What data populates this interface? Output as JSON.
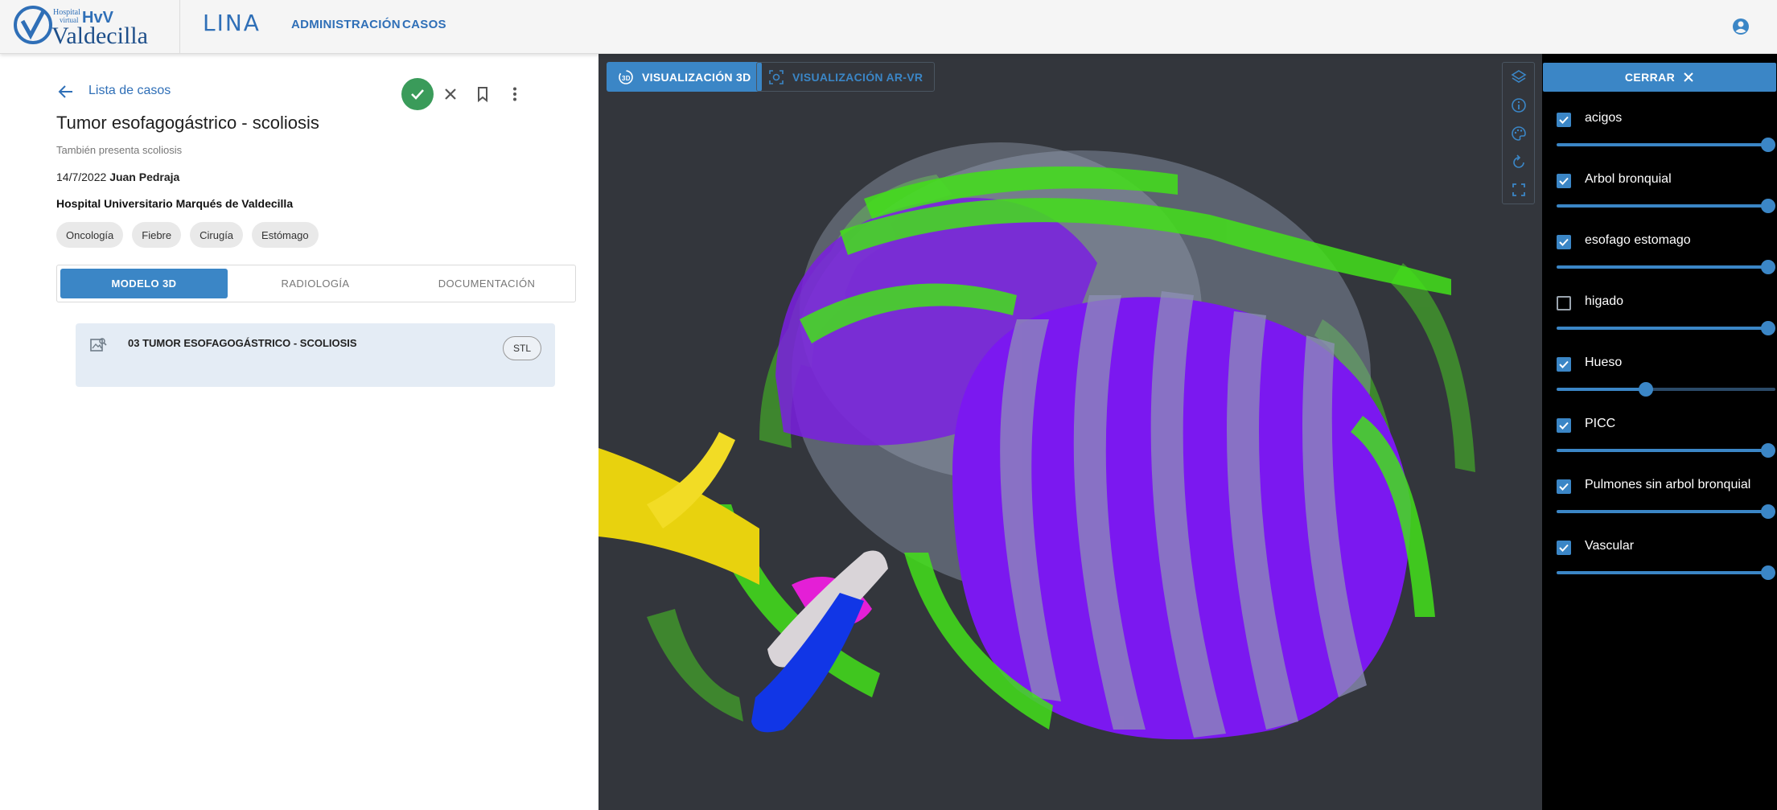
{
  "header": {
    "logo_small_1": "Hospital",
    "logo_small_2": "virtual",
    "logo_hvv": "HvV",
    "logo_name": "Valdecilla",
    "app_name": "LINA",
    "nav": [
      "ADMINISTRACIÓN",
      "CASOS"
    ],
    "user_icon": "account-circle-icon"
  },
  "case": {
    "back_label": "Lista de casos",
    "title": "Tumor esofagogástrico - scoliosis",
    "subtitle": "También presenta scoliosis",
    "date": "14/7/2022",
    "author": "Juan Pedraja",
    "hospital": "Hospital Universitario Marqués de Valdecilla",
    "tags": [
      "Oncología",
      "Fiebre",
      "Cirugía",
      "Estómago"
    ],
    "actions": [
      "check-icon",
      "close-icon",
      "bookmark-icon",
      "more-vert-icon"
    ],
    "status_color": "#3a9b5a"
  },
  "tabs": [
    {
      "label": "MODELO 3D",
      "active": true
    },
    {
      "label": "RADIOLOGÍA",
      "active": false
    },
    {
      "label": "DOCUMENTACIÓN",
      "active": false
    }
  ],
  "files": [
    {
      "name": "03 TUMOR ESOFAGOGÁSTRICO - SCOLIOSIS",
      "format": "STL"
    }
  ],
  "viewer": {
    "tabs": [
      {
        "label": "VISUALIZACIÓN 3D",
        "active": true,
        "icon": "3d-rotation-icon"
      },
      {
        "label": "VISUALIZACIÓN AR-VR",
        "active": false,
        "icon": "ar-scan-icon"
      }
    ],
    "tools": [
      "layers-icon",
      "info-icon",
      "palette-icon",
      "reset-view-icon",
      "fullscreen-icon"
    ],
    "accent": "#3b86c6"
  },
  "layers_panel": {
    "close_label": "CERRAR",
    "layers": [
      {
        "name": "acigos",
        "visible": true,
        "opacity": 1.0
      },
      {
        "name": "Arbol bronquial",
        "visible": true,
        "opacity": 1.0
      },
      {
        "name": "esofago estomago",
        "visible": true,
        "opacity": 1.0
      },
      {
        "name": "higado",
        "visible": false,
        "opacity": 1.0
      },
      {
        "name": "Hueso",
        "visible": true,
        "opacity": 0.4
      },
      {
        "name": "PICC",
        "visible": true,
        "opacity": 1.0
      },
      {
        "name": "Pulmones sin arbol bronquial",
        "visible": true,
        "opacity": 1.0
      },
      {
        "name": "Vascular",
        "visible": true,
        "opacity": 1.0
      }
    ]
  }
}
